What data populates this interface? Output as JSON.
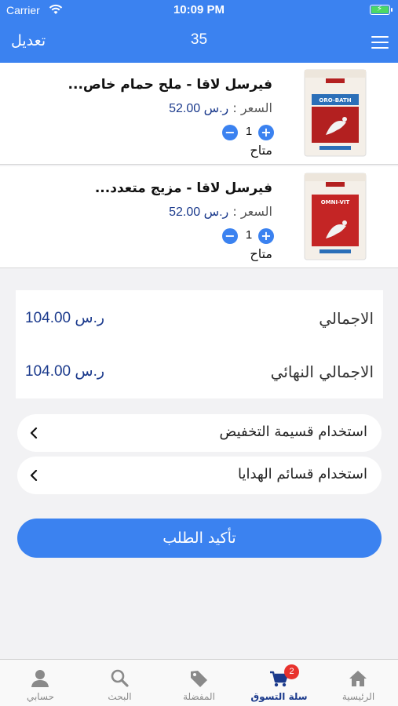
{
  "status_bar": {
    "carrier": "Carrier",
    "time": "10:09 PM"
  },
  "nav": {
    "edit_label": "تعديل",
    "item_count": "35",
    "menu_icon": "hamburger-menu-icon"
  },
  "cart": {
    "items": [
      {
        "name": "فيرسل لاقا - ملح حمام خاص...",
        "price_label": "السعر :",
        "price_value": "ر.س 52.00",
        "quantity": "1",
        "availability": "متاح",
        "product_label": "ORO-BATH"
      },
      {
        "name": "فيرسل لاقا - مزيج متعدد...",
        "price_label": "السعر :",
        "price_value": "ر.س 52.00",
        "quantity": "1",
        "availability": "متاح",
        "product_label": "OMNI-VIT"
      }
    ]
  },
  "totals": {
    "total_label": "الاجمالي",
    "total_value": "ر.س 104.00",
    "final_label": "الاجمالي النهائي",
    "final_value": "ر.س 104.00"
  },
  "options": {
    "coupon_label": "استخدام قسيمة التخفيض",
    "gift_label": "استخدام قسائم الهدايا"
  },
  "confirm_label": "تأكيد الطلب",
  "tabs": [
    {
      "label": "الرئيسية",
      "icon": "home-icon"
    },
    {
      "label": "سلة التسوق",
      "icon": "cart-icon",
      "badge": "2"
    },
    {
      "label": "المفضلة",
      "icon": "tag-icon"
    },
    {
      "label": "البحث",
      "icon": "search-icon"
    },
    {
      "label": "حسابي",
      "icon": "user-icon"
    }
  ],
  "colors": {
    "primary": "#3b82f0",
    "price": "#1b3a8c",
    "badge": "#e8322d",
    "background": "#f2f2f4"
  }
}
